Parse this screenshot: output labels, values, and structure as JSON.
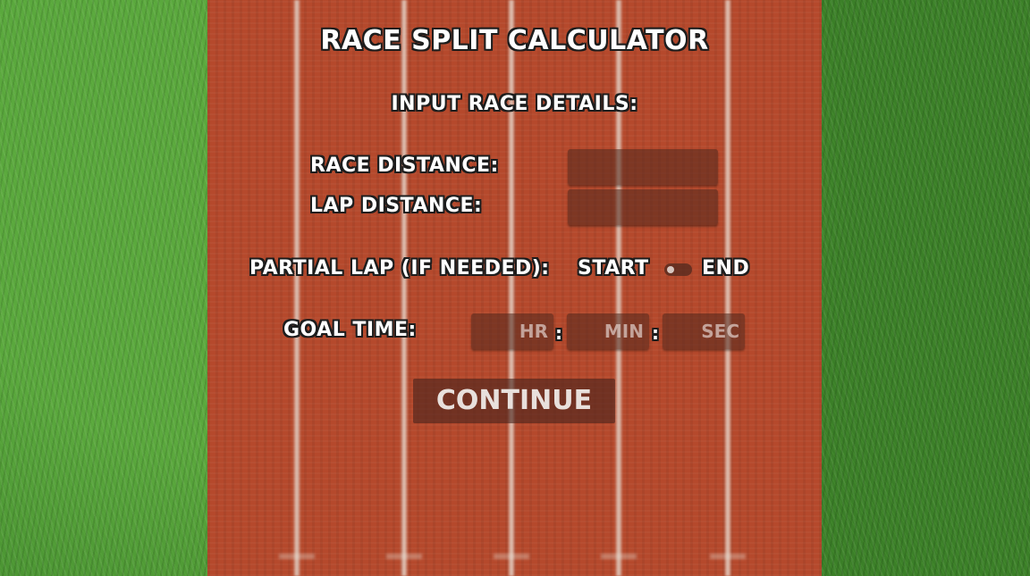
{
  "app": {
    "title": "RACE SPLIT CALCULATOR",
    "subtitle": "INPUT RACE DETAILS:"
  },
  "form": {
    "race_distance": {
      "label": "RACE DISTANCE:",
      "value": ""
    },
    "lap_distance": {
      "label": "LAP DISTANCE:",
      "value": ""
    },
    "partial_lap": {
      "label": "PARTIAL LAP (IF NEEDED):",
      "option_left": "START",
      "option_right": "END",
      "selected": "START"
    },
    "goal_time": {
      "label": "GOAL TIME:",
      "hours_placeholder": "HR",
      "minutes_placeholder": "MIN",
      "seconds_placeholder": "SEC",
      "separator": ":"
    }
  },
  "actions": {
    "continue_label": "CONTINUE"
  },
  "colors": {
    "track": "#b5492c",
    "grass": "#3f8a2c",
    "input_bg": "#50281e",
    "text": "#ffffff",
    "text_outline": "#1d1d1d"
  }
}
